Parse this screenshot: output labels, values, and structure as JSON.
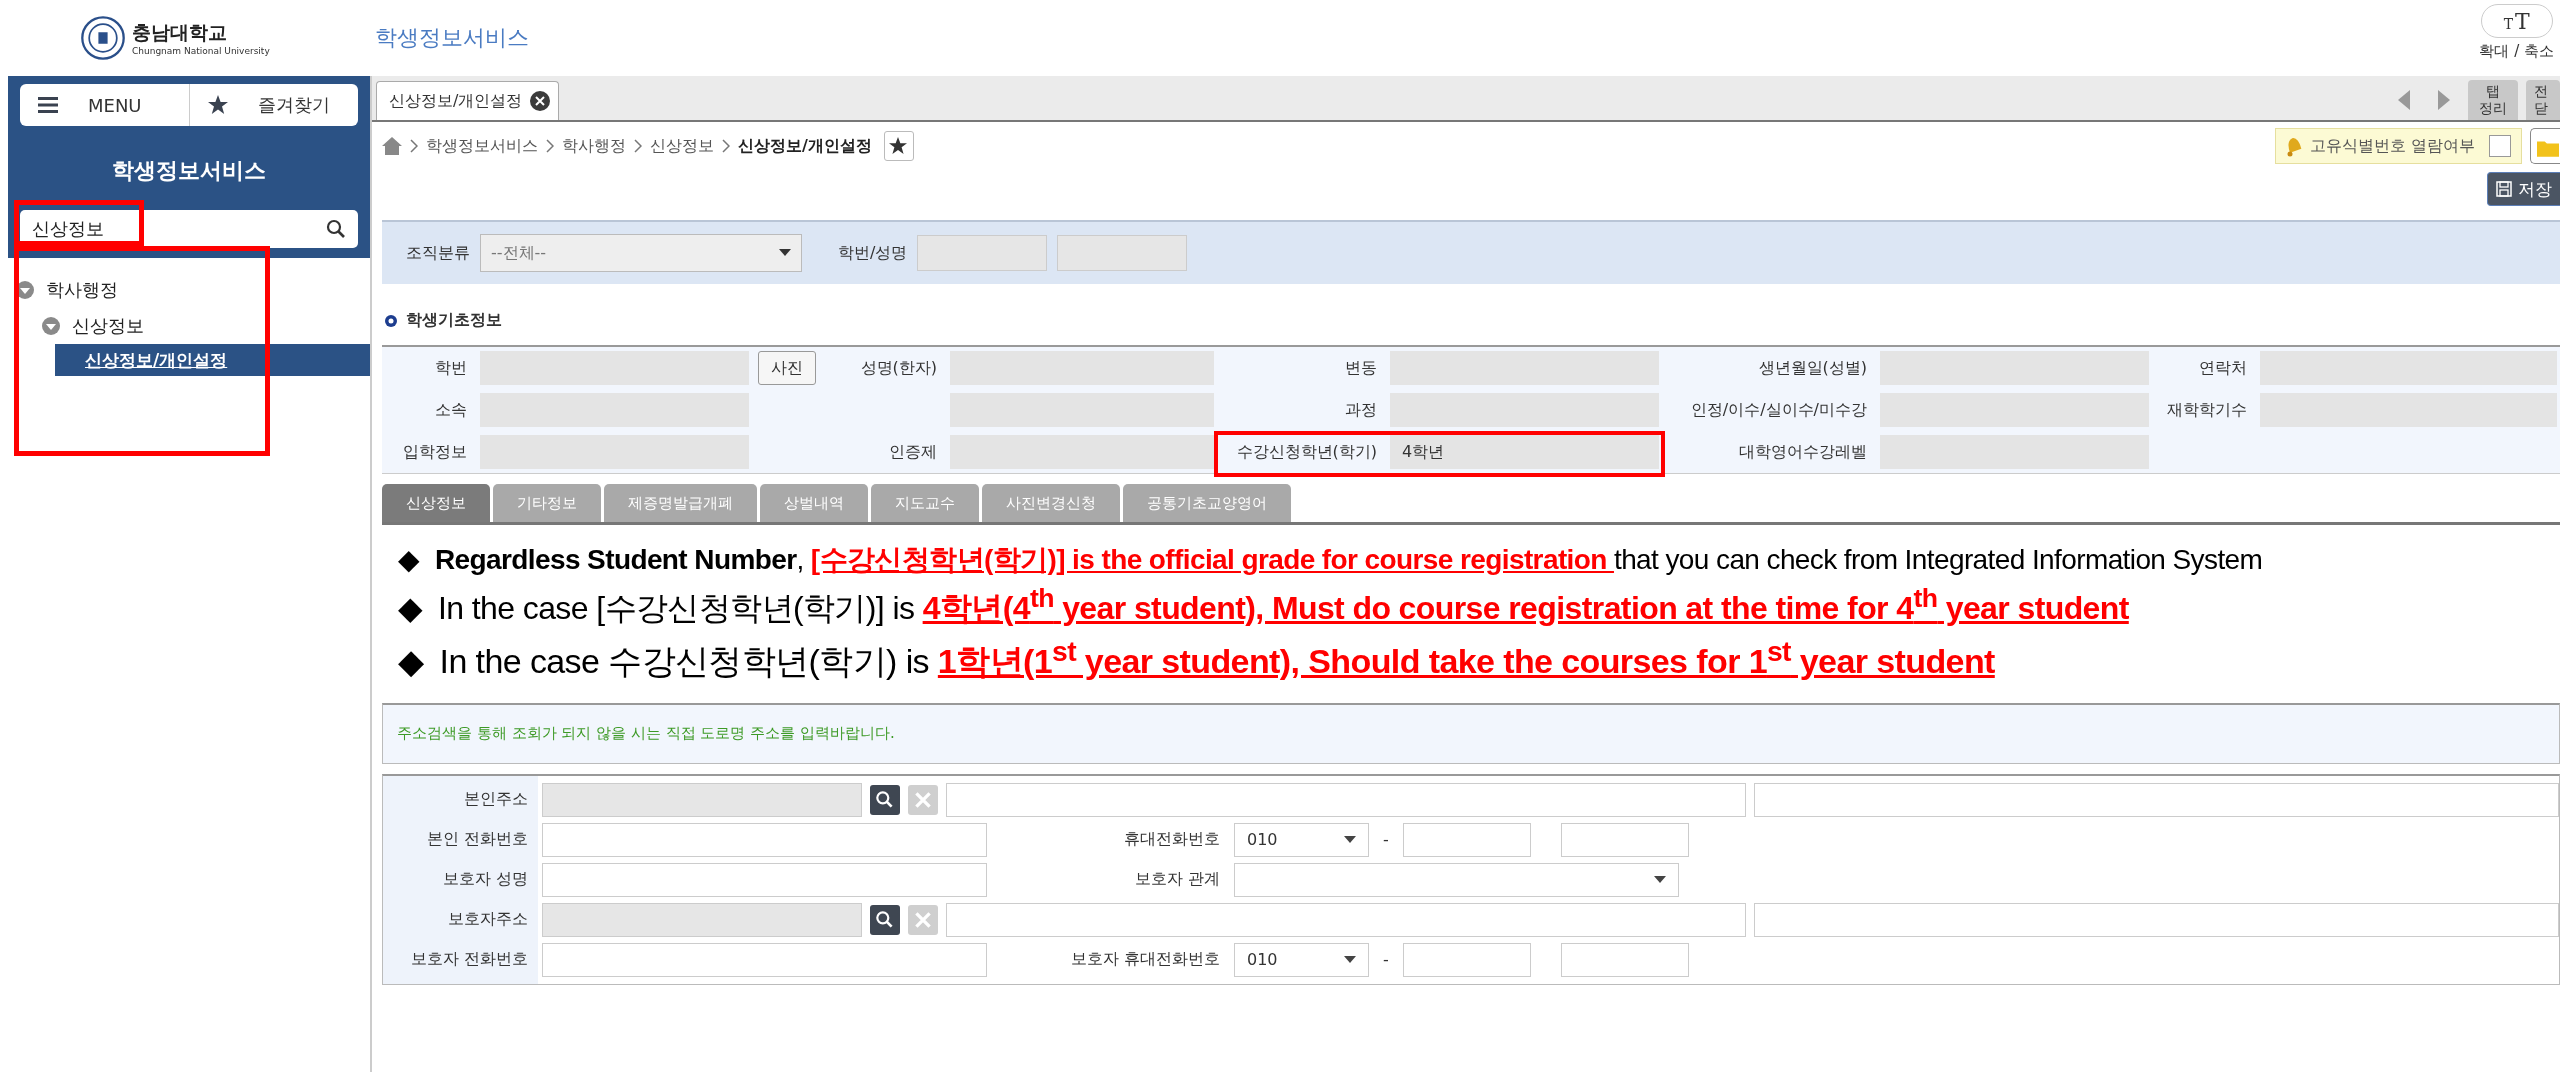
{
  "header": {
    "logo_name": "충남대학교",
    "logo_subtitle": "Chungnam National University",
    "service_title": "학생정보서비스",
    "zoom_button": {
      "small": "T",
      "large": "T"
    },
    "zoom_label": "확대 / 축소"
  },
  "sidebar": {
    "menu_button": "MENU",
    "favorites_button": "즐겨찾기",
    "title": "학생정보서비스",
    "search": {
      "value": "신상정보"
    },
    "tree": [
      {
        "label": "학사행정",
        "expanded": true,
        "children": [
          {
            "label": "신상정보",
            "expanded": true,
            "children": [
              {
                "label": "신상정보/개인설정",
                "selected": true
              }
            ]
          }
        ]
      }
    ]
  },
  "tabs": [
    {
      "label": "신상정보/개인설정",
      "selected": true
    }
  ],
  "tab_tools": {
    "tidy_button": [
      "탭",
      "정리"
    ],
    "close_all_button": [
      "전",
      "닫"
    ]
  },
  "breadcrumb": [
    "학생정보서비스",
    "학사행정",
    "신상정보",
    "신상정보/개인설정"
  ],
  "privacy": {
    "label": "고유식별번호 열람여부",
    "checked": false
  },
  "save_button": "저장",
  "filter": {
    "org_label": "조직분류",
    "org_value": "--전체--",
    "student_label": "학번/성명"
  },
  "basic_info": {
    "title": "학생기초정보",
    "rows": [
      [
        {
          "kind": "label",
          "text": "학번"
        },
        {
          "kind": "value"
        },
        {
          "kind": "button",
          "text": "사진"
        },
        {
          "kind": "label",
          "text": "성명(한자)"
        },
        {
          "kind": "value"
        },
        {
          "kind": "label",
          "text": "변동"
        },
        {
          "kind": "value"
        },
        {
          "kind": "label",
          "text": "생년월일(성별)"
        },
        {
          "kind": "value"
        },
        {
          "kind": "label",
          "text": "연락처"
        },
        {
          "kind": "value"
        }
      ],
      [
        {
          "kind": "label",
          "text": "소속"
        },
        {
          "kind": "value"
        },
        {
          "kind": "blank"
        },
        {
          "kind": "blank"
        },
        {
          "kind": "value"
        },
        {
          "kind": "label",
          "text": "과정"
        },
        {
          "kind": "value"
        },
        {
          "kind": "label",
          "text": "인정/이수/실이수/미수강"
        },
        {
          "kind": "value"
        },
        {
          "kind": "label",
          "text": "재학학기수"
        },
        {
          "kind": "value"
        }
      ],
      [
        {
          "kind": "label",
          "text": "입학정보"
        },
        {
          "kind": "value"
        },
        {
          "kind": "blank"
        },
        {
          "kind": "label",
          "text": "인증제"
        },
        {
          "kind": "value"
        },
        {
          "kind": "label",
          "text": "수강신청학년(학기)",
          "boxed": true
        },
        {
          "kind": "value",
          "text": "4학년",
          "boxed": true
        },
        {
          "kind": "label",
          "text": "대학영어수강레벨"
        },
        {
          "kind": "value"
        },
        {
          "kind": "blank"
        },
        {
          "kind": "blank"
        }
      ]
    ]
  },
  "info_tabs": [
    {
      "label": "신상정보",
      "selected": true
    },
    {
      "label": "기타정보",
      "selected": false
    },
    {
      "label": "제증명발급개폐",
      "selected": false
    },
    {
      "label": "상벌내역",
      "selected": false
    },
    {
      "label": "지도교수",
      "selected": false
    },
    {
      "label": "사진변경신청",
      "selected": false
    },
    {
      "label": "공통기초교양영어",
      "selected": false
    }
  ],
  "annotations": [
    {
      "bullet": "◆",
      "segments": [
        {
          "kind": "plain",
          "text": "**Regardless Student Number**, "
        },
        {
          "kind": "emphasis",
          "text": "[수강신청학년(학기)] is the official grade for course registration "
        },
        {
          "kind": "plain",
          "text": "that you can check from Integrated Information System"
        }
      ]
    },
    {
      "bullet": "◆",
      "segments": [
        {
          "kind": "plain",
          "text": "In the case [수강신청학년(학기)] is "
        },
        {
          "kind": "emphasis",
          "text": "4학년(4$^{th}$ year student), Must do course registration at the time for 4$^{th}$ year student"
        }
      ]
    },
    {
      "bullet": "◆",
      "segments": [
        {
          "kind": "plain",
          "text": "In the case 수강신청학년(학기) is "
        },
        {
          "kind": "emphasis",
          "text": "1학년(1$^{st}$ year student), Should take the courses for 1$^{st}$ year student"
        }
      ]
    }
  ],
  "notice": "주소검색을 통해 조회가 되지 않을 시는 직접 도로명 주소를 입력바랍니다.",
  "address_form": [
    {
      "kind": "address",
      "label": "본인주소"
    },
    {
      "kind": "phone",
      "label": "본인 전화번호",
      "mobile_label": "휴대전화번호",
      "mobile_prefix": "010",
      "dash": "-"
    },
    {
      "kind": "relation",
      "label": "보호자 성명",
      "relation_label": "보호자 관계"
    },
    {
      "kind": "address",
      "label": "보호자주소"
    },
    {
      "kind": "phone",
      "label": "보호자 전화번호",
      "mobile_label": "보호자 휴대전화번호",
      "mobile_prefix": "010",
      "dash": "-"
    }
  ]
}
